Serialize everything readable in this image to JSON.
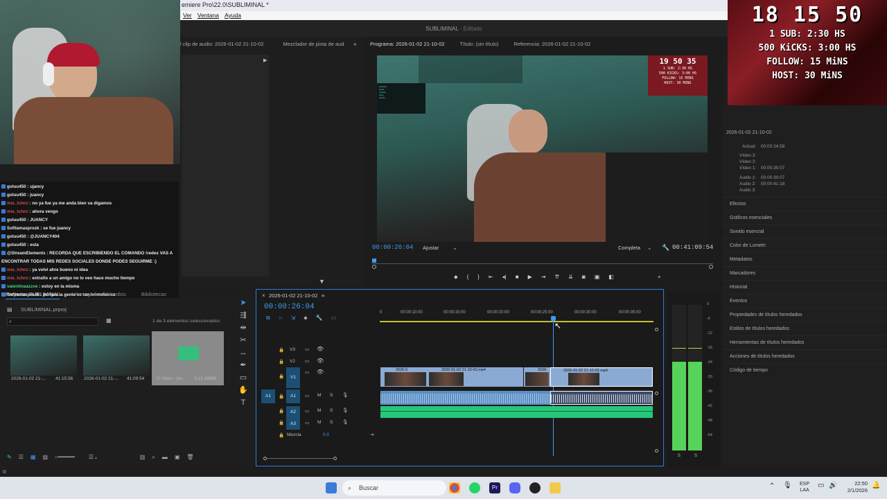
{
  "window": {
    "title": "emiere Pro\\22.0\\SUBLIMINAL *",
    "menu": [
      "Ver",
      "Ventana",
      "Ayuda"
    ],
    "document_title": "SUBLIMINAL",
    "document_state": "- Editado"
  },
  "source_panel": {
    "tabs": [
      "l clip de audio: 2026-01-02 21-10-02",
      "Mezclador de pista de aud"
    ]
  },
  "program_panel": {
    "tabs": [
      "Programa: 2026-01-02 21-10-02",
      "Título: (sin título)",
      "Referencia: 2026-01-02 21-10-02"
    ],
    "current_time": "00:00:26:04",
    "fit_label": "Ajustar",
    "quality_label": "Completa",
    "duration": "00:41:09:54",
    "inner_overlay": {
      "clock": "19 50 35",
      "lines": [
        "1 SUB: 2:30 HS",
        "500 KICKS: 3:00 HS",
        "FOLLOW: 15 MINS",
        "HOST: 30 MINS"
      ]
    }
  },
  "stream_overlay": {
    "clock": "18 15 50",
    "goals": [
      "1 SUB: 2:30 HS",
      "500 KiCKS: 3:00 HS",
      "FOLLOW: 15 MiNS",
      "HOST: 30 MiNS"
    ]
  },
  "chat": {
    "messages": [
      {
        "user": "goluu450",
        "text": " : ujancy",
        "color": "#e8e8e8"
      },
      {
        "user": "goluu450",
        "text": " : juancy",
        "color": "#e8e8e8"
      },
      {
        "user": "mia_tchnz",
        "text": " : no ya fue ya me anda bien va digamos",
        "color": "#d84b4b"
      },
      {
        "user": "mia_tchnz",
        "text": " : ahora vengo",
        "color": "#d84b4b"
      },
      {
        "user": "goluu450",
        "text": " : JUANCY",
        "color": "#e8e8e8"
      },
      {
        "user": "Sofilamasprozk",
        "text": " : se fue juancy",
        "color": "#e8e8e8"
      },
      {
        "user": "goluu450",
        "text": " : @JUANCY404",
        "color": "#e8e8e8"
      },
      {
        "user": "goluu450",
        "text": " : esta",
        "color": "#e8e8e8"
      },
      {
        "user": "@StreamElements",
        "text": " : RECORDA QUE ESCRIBIENDO EL COMANDO !redes VAS A",
        "color": "#e8e8e8"
      },
      {
        "user": "",
        "text": "ENCONTRAR TODAS MIS REDES SOCIALES DONDE PODES SEGUIRME :)",
        "color": "#e8e8e8"
      },
      {
        "user": "mia_tchnz",
        "text": " : ya volvi ahre bueno ni idea",
        "color": "#d84b4b"
      },
      {
        "user": "mia_tchnz",
        "text": " : extraño a un amigo no lo veo hace mucho tiempo",
        "color": "#d84b4b"
      },
      {
        "user": "valentinaazzoe",
        "text": " : estoy en la misma",
        "color": "#4fd37a"
      },
      {
        "user": "Sofilamasprozk",
        "text": " : porque la gente es tan homofobica",
        "color": "#e8e8e8"
      }
    ]
  },
  "project_panel": {
    "tabs": [
      "Proyecto: SUBLIMINAL",
      "Navegador de medios",
      "Bibliotecas"
    ],
    "project_file": "SUBLIMINAL.prproj",
    "selection_info": "1 de 3 elementos seleccionados",
    "items": [
      {
        "name": "2026-01-02 21-...",
        "duration": "41:15:56"
      },
      {
        "name": "2026-01-02 21-...",
        "duration": "41:09:54"
      },
      {
        "name": "G-Yerro - Un...",
        "duration": "3:13:16956"
      }
    ]
  },
  "timeline": {
    "sequence_tab": "2026-01-02 21-10-02",
    "timecode": "00:00:26:04",
    "ruler_labels": [
      "0",
      "00:00:10:00",
      "00:00:15:00",
      "00:00:20:00",
      "00:00:25:00",
      "00:00:30:00",
      "00:00:35:00"
    ],
    "tracks": {
      "video": [
        "V3",
        "V2",
        "V1"
      ],
      "audio": [
        "A1",
        "A2",
        "A3"
      ],
      "source_v": "V1",
      "source_a": "A1",
      "mix_label": "Mezcla",
      "mix_value": "0,0",
      "m_label": "M",
      "s_label": "S"
    },
    "clips": {
      "v1_a": "2026-0",
      "v1_b": "2026-01-02 21-10-02.mp4",
      "v1_c": "2026-",
      "v1_d": "2026-01-02 21-10-02.mp4"
    }
  },
  "meters": {
    "scale": [
      "0",
      "-6",
      "-12",
      "-18",
      "-24",
      "-30",
      "-36",
      "-42",
      "-48",
      "-54"
    ],
    "solo": [
      "S",
      "S"
    ]
  },
  "info_panel": {
    "sequence": "2026-01-02 21-10-02",
    "current_label": "Actual:",
    "current_value": "00:00:24:58",
    "tracks": [
      {
        "label": "Vídeo 3:",
        "value": ""
      },
      {
        "label": "Vídeo 2:",
        "value": ""
      },
      {
        "label": "Vídeo 1:",
        "value": "00:00:30:07"
      },
      {
        "label": "Audio 1:",
        "value": "00:00:30:07"
      },
      {
        "label": "Audio 2:",
        "value": "00:00:41:18"
      },
      {
        "label": "Audio 3:",
        "value": ""
      }
    ],
    "panels": [
      "Efectos",
      "Gráficos esenciales",
      "Sonido esencial",
      "Color de Lumetri",
      "Metadatos",
      "Marcadores",
      "Historial",
      "Eventos",
      "Propiedades de títulos heredados",
      "Estilos de títulos heredados",
      "Herramientas de títulos heredados",
      "Acciones de títulos heredados",
      "Código de tiempo"
    ]
  },
  "taskbar": {
    "search_placeholder": "Buscar",
    "lang_top": "ESP",
    "lang_bottom": "LAA",
    "time": "22:50",
    "date": "2/1/2026"
  }
}
